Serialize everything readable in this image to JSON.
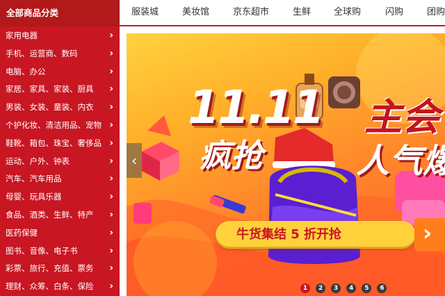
{
  "sidebar": {
    "header": "全部商品分类",
    "arrow": "›",
    "items": [
      {
        "label": "家用电器"
      },
      {
        "label": "手机、运营商、数码"
      },
      {
        "label": "电脑、办公"
      },
      {
        "label": "家居、家具、家装、厨具"
      },
      {
        "label": "男装、女装、童装、内衣"
      },
      {
        "label": "个护化妆、清洁用品、宠物"
      },
      {
        "label": "鞋靴、箱包、珠宝、奢侈品"
      },
      {
        "label": "运动、户外、钟表"
      },
      {
        "label": "汽车、汽车用品"
      },
      {
        "label": "母婴、玩具乐器"
      },
      {
        "label": "食品、酒类、生鲜、特产"
      },
      {
        "label": "医药保健"
      },
      {
        "label": "图书、音像、电子书"
      },
      {
        "label": "彩票、旅行、充值、票务"
      },
      {
        "label": "理财、众筹、白条、保险"
      }
    ]
  },
  "topnav": {
    "items": [
      {
        "label": "服装城"
      },
      {
        "label": "美妆馆"
      },
      {
        "label": "京东超市"
      },
      {
        "label": "生鲜"
      },
      {
        "label": "全球购"
      },
      {
        "label": "闪购"
      },
      {
        "label": "团购"
      }
    ]
  },
  "banner": {
    "headline_date": "11.11",
    "headline_main": "主会",
    "headline_crazy": "疯抢",
    "headline_pop": "人气爆",
    "cta_text": "牛货集结 5 折开抢",
    "cta_arrow": "›",
    "prev_arrow": "‹",
    "dots": [
      "1",
      "2",
      "3",
      "4",
      "5",
      "6"
    ],
    "active_dot": 1,
    "colors": {
      "brand_red": "#c81623",
      "cta_yellow": "#ffd23c",
      "cta_orange": "#ff7d1a"
    }
  }
}
